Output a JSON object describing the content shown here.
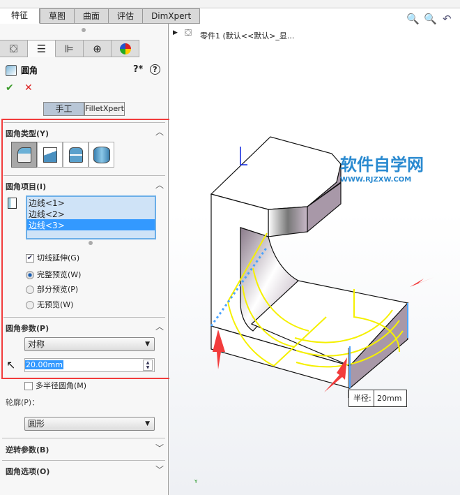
{
  "command_tabs": [
    "特征",
    "草图",
    "曲面",
    "评估",
    "DimXpert"
  ],
  "panel": {
    "tabs": [
      "feature-manager",
      "property-manager",
      "configuration-manager",
      "dimxpert-manager",
      "display-manager"
    ],
    "title": "圆角",
    "ok": "✔",
    "cancel": "✕",
    "mode_buttons": [
      "手工",
      "FilletXpert"
    ],
    "fillet_type": {
      "title": "圆角类型(Y)",
      "options": [
        "constant-size",
        "variable-size",
        "face-fillet",
        "full-round"
      ]
    },
    "fillet_items": {
      "title": "圆角项目(I)",
      "list": [
        "边线<1>",
        "边线<2>",
        "边线<3>"
      ],
      "selected_index": 2,
      "tangent_propagation": "切线延伸(G)",
      "tangent_checked": true,
      "preview": [
        "完整预览(W)",
        "部分预览(P)",
        "无预览(W)"
      ],
      "preview_selected": 0
    },
    "fillet_params": {
      "title": "圆角参数(P)",
      "method": "对称",
      "radius": "20.00mm",
      "multi_radius": "多半径圆角(M)",
      "profile_label": "轮廓(P)：",
      "profile": "圆形"
    },
    "setback": {
      "title": "逆转参数(B)"
    },
    "options": {
      "title": "圆角选项(O)"
    }
  },
  "viewport": {
    "tree_item": "零件1  (默认<<默认>_显...",
    "radius_label": "半径:",
    "radius_value": "20mm",
    "watermark": "软件自学网",
    "watermark_url": "WWW.RJZXW.COM",
    "axis_label": "Y"
  },
  "colors": {
    "highlight": "#ff3b3b",
    "preview": "#f5f000",
    "selection": "#3399ff",
    "edge_blue": "#4aa3ff"
  }
}
